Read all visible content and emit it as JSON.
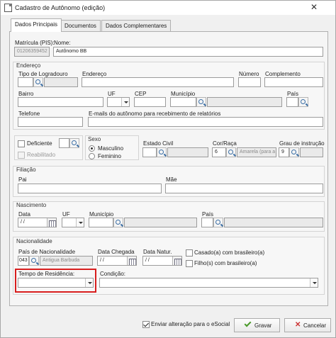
{
  "window": {
    "title": "Cadastro de Autônomo (edição)",
    "close_glyph": "✕"
  },
  "tabs": [
    {
      "label": "Dados Principais"
    },
    {
      "label": "Documentos"
    },
    {
      "label": "Dados Complementares"
    }
  ],
  "header": {
    "matricula_label": "Matrícula (PIS):",
    "matricula_value": "01206359452",
    "nome_label": "Nome:",
    "nome_value": "Autônomo BB"
  },
  "endereco": {
    "title": "Endereço",
    "tipo_logradouro_label": "Tipo de Logradouro",
    "endereco_label": "Endereço",
    "numero_label": "Número",
    "complemento_label": "Complemento",
    "bairro_label": "Bairro",
    "uf_label": "UF",
    "cep_label": "CEP",
    "municipio_label": "Município",
    "pais_label": "País",
    "telefone_label": "Telefone",
    "emails_label": "E-mails do autônomo para recebimento de relatórios"
  },
  "deficiente": {
    "deficiente_label": "Deficiente",
    "reabilitado_label": "Reabilitado"
  },
  "sexo": {
    "title": "Sexo",
    "masculino_label": "Masculino",
    "feminino_label": "Feminino"
  },
  "estado_civil_label": "Estado Civil",
  "cor_raca": {
    "label": "Cor/Raça",
    "code": "6",
    "value": "Amarela (para a"
  },
  "grau_instrucao": {
    "label": "Grau de instrução",
    "code": "9"
  },
  "filiacao": {
    "title": "Filiação",
    "pai_label": "Pai",
    "mae_label": "Mãe"
  },
  "nascimento": {
    "title": "Nascimento",
    "data_label": "Data",
    "data_value": "  /  /",
    "uf_label": "UF",
    "municipio_label": "Município",
    "pais_label": "País"
  },
  "nacionalidade": {
    "title": "Nacionalidade",
    "pais_label": "País de Nacionalidade",
    "pais_code": "043",
    "pais_name": "Antigua Barbuda",
    "data_chegada_label": "Data Chegada",
    "data_chegada_value": "  /  /",
    "data_natur_label": "Data Natur.",
    "data_natur_value": "  /  /",
    "casado_label": "Casado(a) com brasileiro(a)",
    "filhos_label": "Filho(s) com brasileiro(a)",
    "tempo_residencia_label": "Tempo de Residência:",
    "condicao_label": "Condição:"
  },
  "footer": {
    "enviar_label": "Enviar alteração para o eSocial",
    "gravar_label": "Gravar",
    "cancelar_label": "Cancelar"
  }
}
